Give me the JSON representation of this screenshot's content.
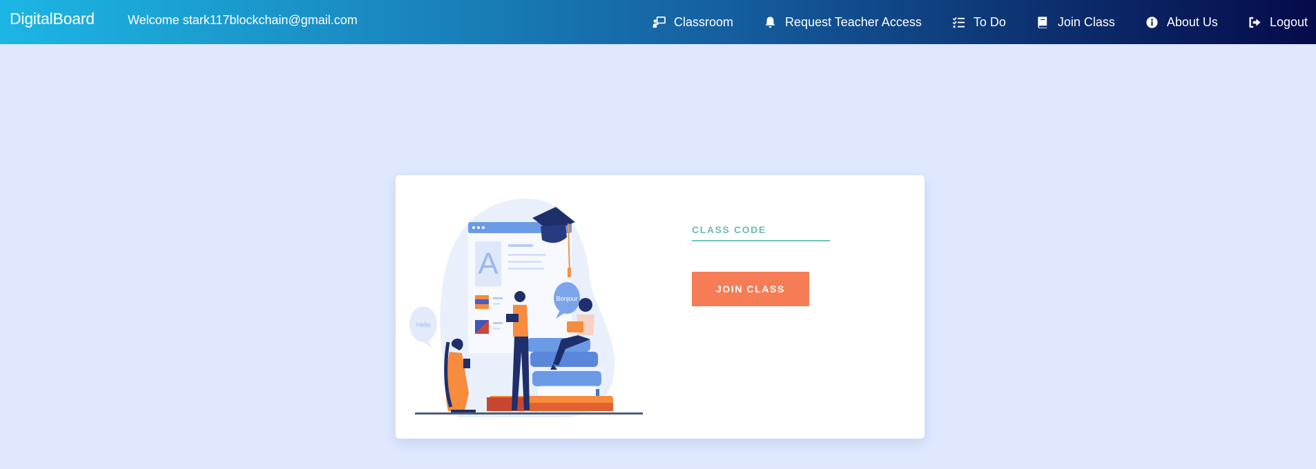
{
  "app": {
    "brand": "DigitalBoard",
    "welcome": "Welcome stark117blockchain@gmail.com"
  },
  "nav": {
    "items": [
      {
        "label": "Classroom",
        "icon": "chalkboard-user-icon"
      },
      {
        "label": "Request Teacher Access",
        "icon": "bell-icon"
      },
      {
        "label": "To Do",
        "icon": "checklist-icon"
      },
      {
        "label": "Join Class",
        "icon": "book-icon"
      },
      {
        "label": "About Us",
        "icon": "info-circle-icon"
      },
      {
        "label": "Logout",
        "icon": "sign-out-icon"
      }
    ]
  },
  "join_form": {
    "class_code_placeholder": "CLASS CODE",
    "class_code_value": "",
    "join_label": "JOIN CLASS"
  },
  "illustration": {
    "icon": "students-studying-illustration",
    "bubble_left": "Hello",
    "bubble_right": "Bonjour",
    "board_letter": "A"
  },
  "colors": {
    "nav_gradient_start": "#1cb6e4",
    "nav_gradient_end": "#050a4a",
    "page_background": "#dfe8fe",
    "accent_button": "#f67c55",
    "input_underline": "#6cc5bb"
  }
}
